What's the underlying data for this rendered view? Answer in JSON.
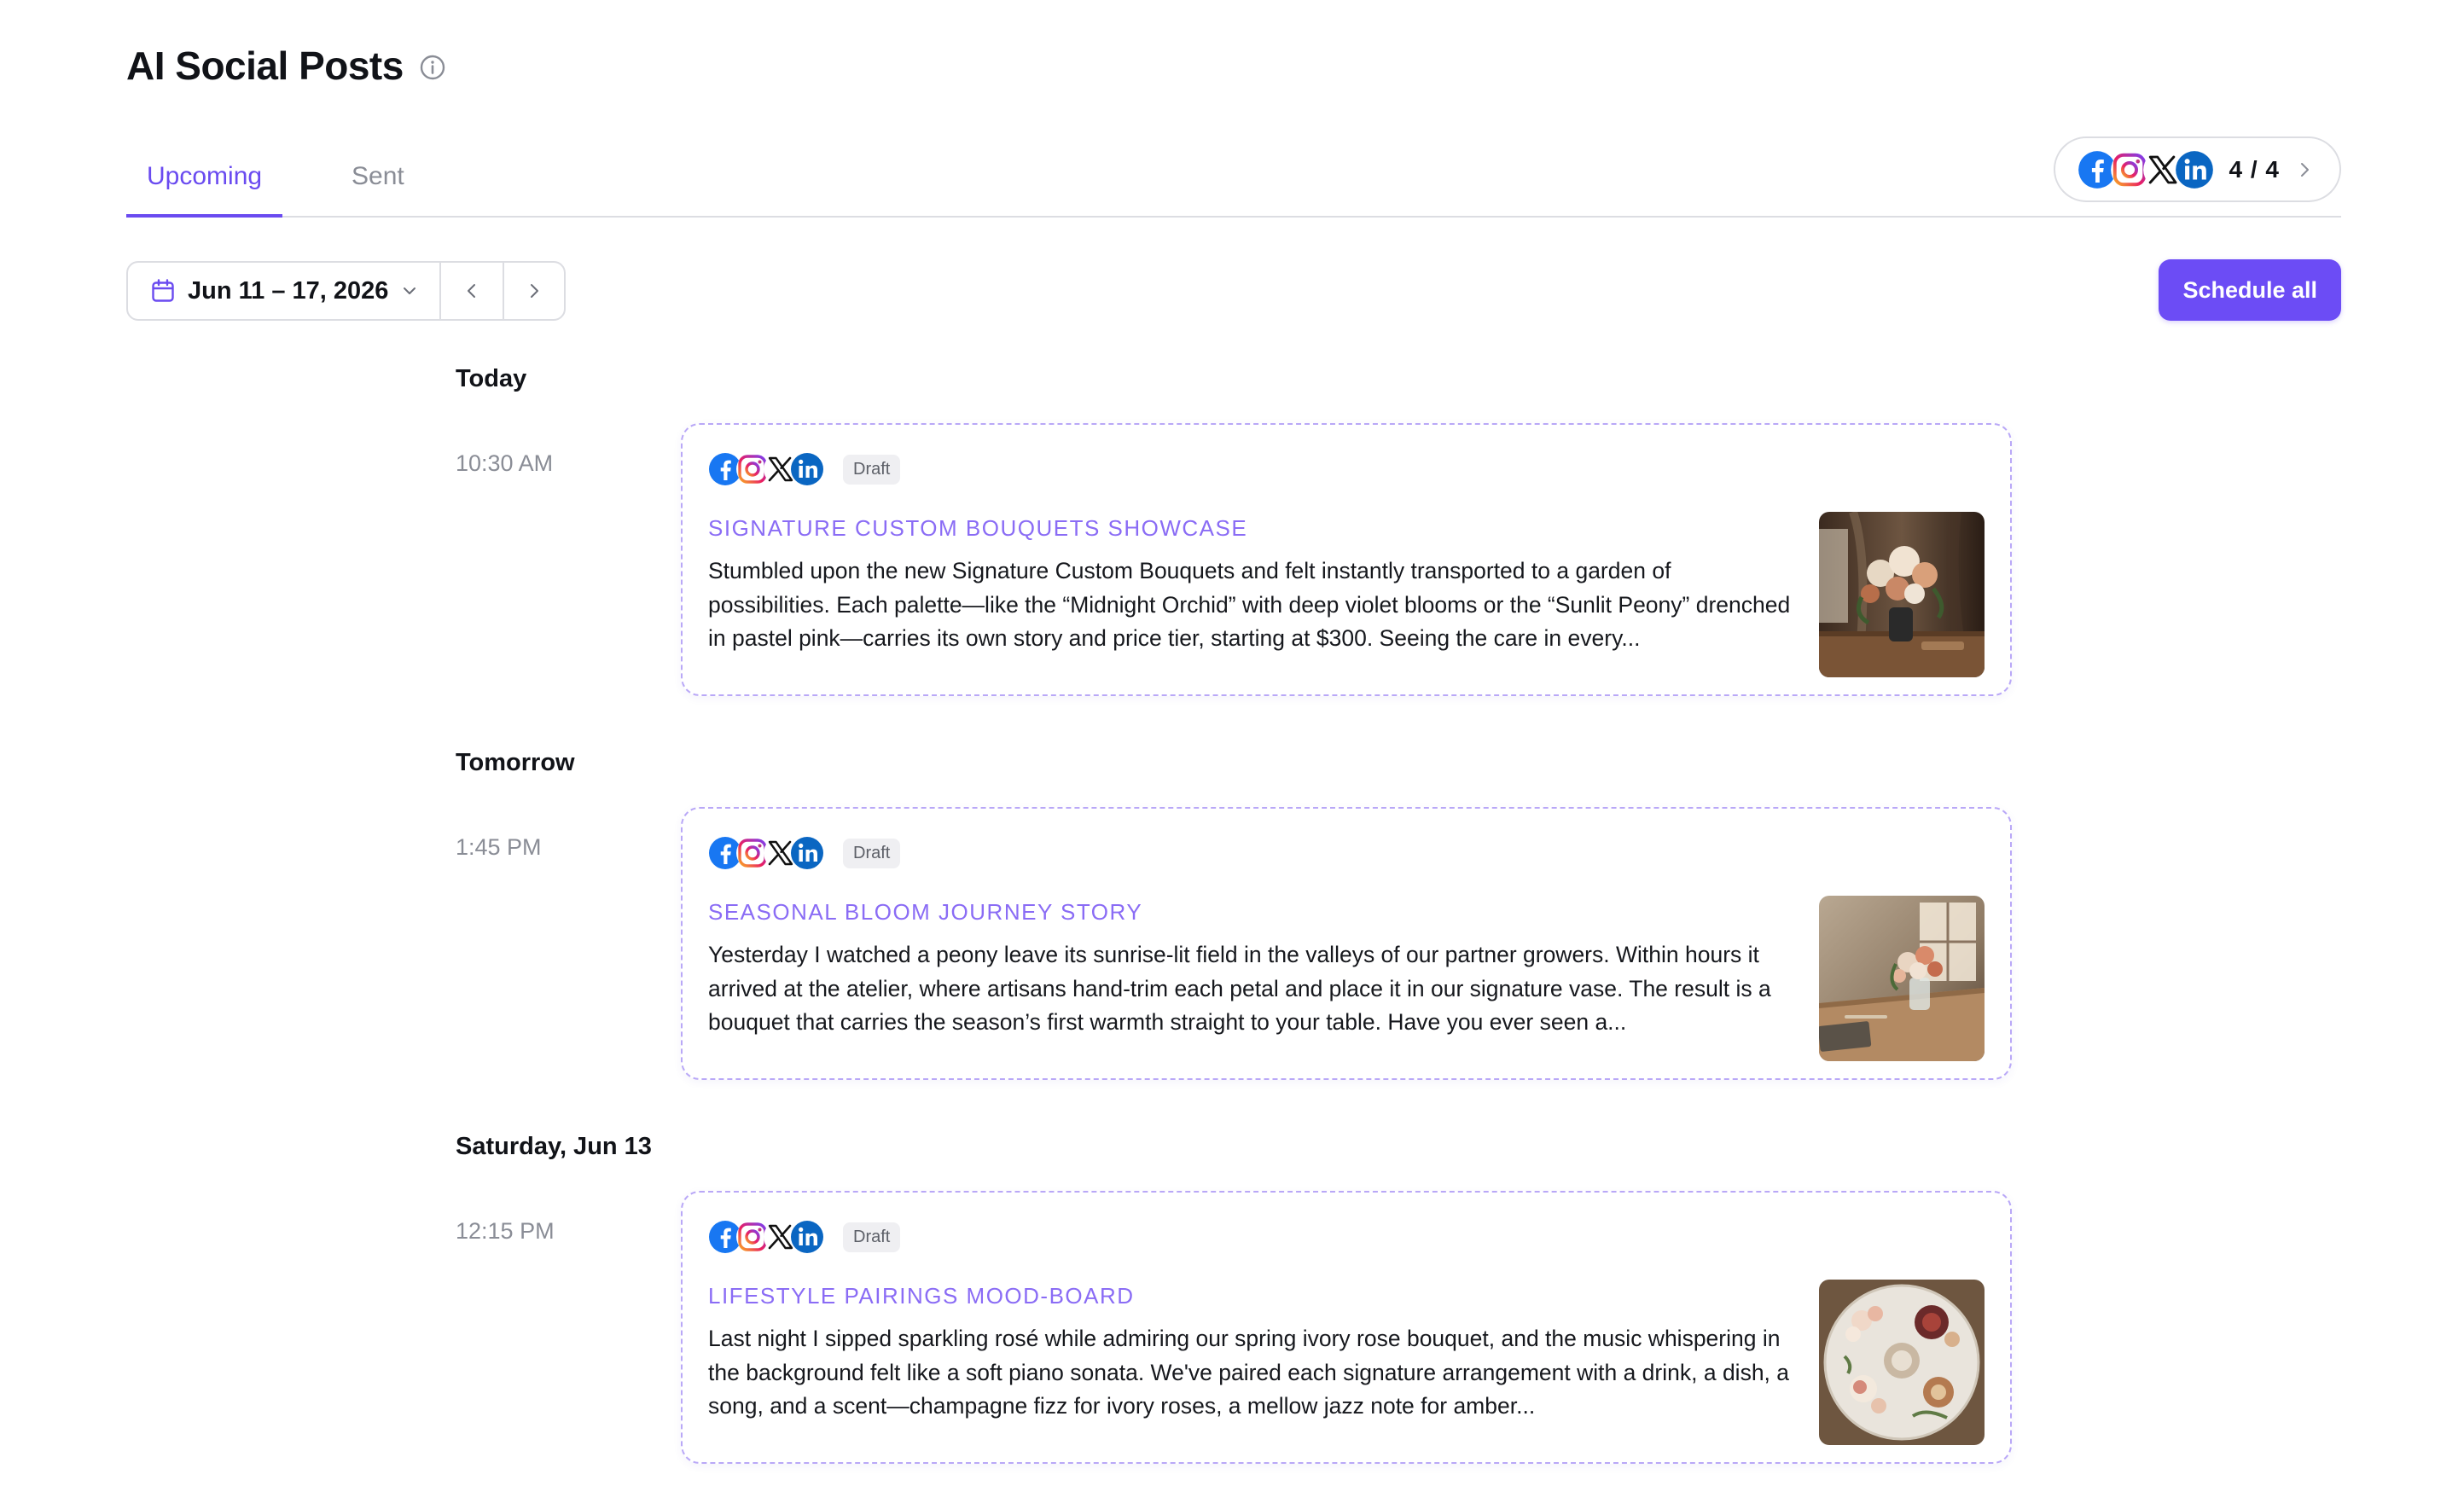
{
  "header": {
    "title": "AI Social Posts",
    "info_icon": "info-icon"
  },
  "tabs": [
    {
      "label": "Upcoming",
      "active": true
    },
    {
      "label": "Sent",
      "active": false
    }
  ],
  "channels": {
    "icons": [
      "facebook-icon",
      "instagram-icon",
      "x-icon",
      "linkedin-icon"
    ],
    "count_label": "4 / 4"
  },
  "date_range": {
    "label": "Jun 11 – 17, 2026",
    "icon": "calendar-icon"
  },
  "toolbar": {
    "schedule_all_label": "Schedule all"
  },
  "colors": {
    "accent": "#6c4cf5",
    "title_accent": "#8a6cf5",
    "card_border": "#b9a8f7",
    "muted": "#8a8d96"
  },
  "sections": [
    {
      "day": "Today",
      "posts": [
        {
          "time": "10:30 AM",
          "status": "Draft",
          "title": "SIGNATURE CUSTOM BOUQUETS SHOWCASE",
          "body": "Stumbled upon the new Signature Custom Bouquets and felt instantly transported to a garden of possibilities. Each palette—like the “Midnight Orchid” with deep violet blooms or the “Sunlit Peony” drenched in pastel pink—carries its own story and price tier, starting at $300. Seeing the care in every..."
        }
      ]
    },
    {
      "day": "Tomorrow",
      "posts": [
        {
          "time": "1:45 PM",
          "status": "Draft",
          "title": "SEASONAL BLOOM JOURNEY STORY",
          "body": "Yesterday I watched a peony leave its sunrise-lit field in the valleys of our partner growers. Within hours it arrived at the atelier, where artisans hand-trim each petal and place it in our signature vase. The result is a bouquet that carries the season’s first warmth straight to your table. Have you ever seen a..."
        }
      ]
    },
    {
      "day": "Saturday, Jun 13",
      "posts": [
        {
          "time": "12:15 PM",
          "status": "Draft",
          "title": "LIFESTYLE PAIRINGS MOOD-BOARD",
          "body": "Last night I sipped sparkling rosé while admiring our spring ivory rose bouquet, and the music whispering in the background felt like a soft piano sonata. We've paired each signature arrangement with a drink, a dish, a song, and a scent—champagne fizz for ivory roses, a mellow jazz note for amber..."
        }
      ]
    }
  ]
}
